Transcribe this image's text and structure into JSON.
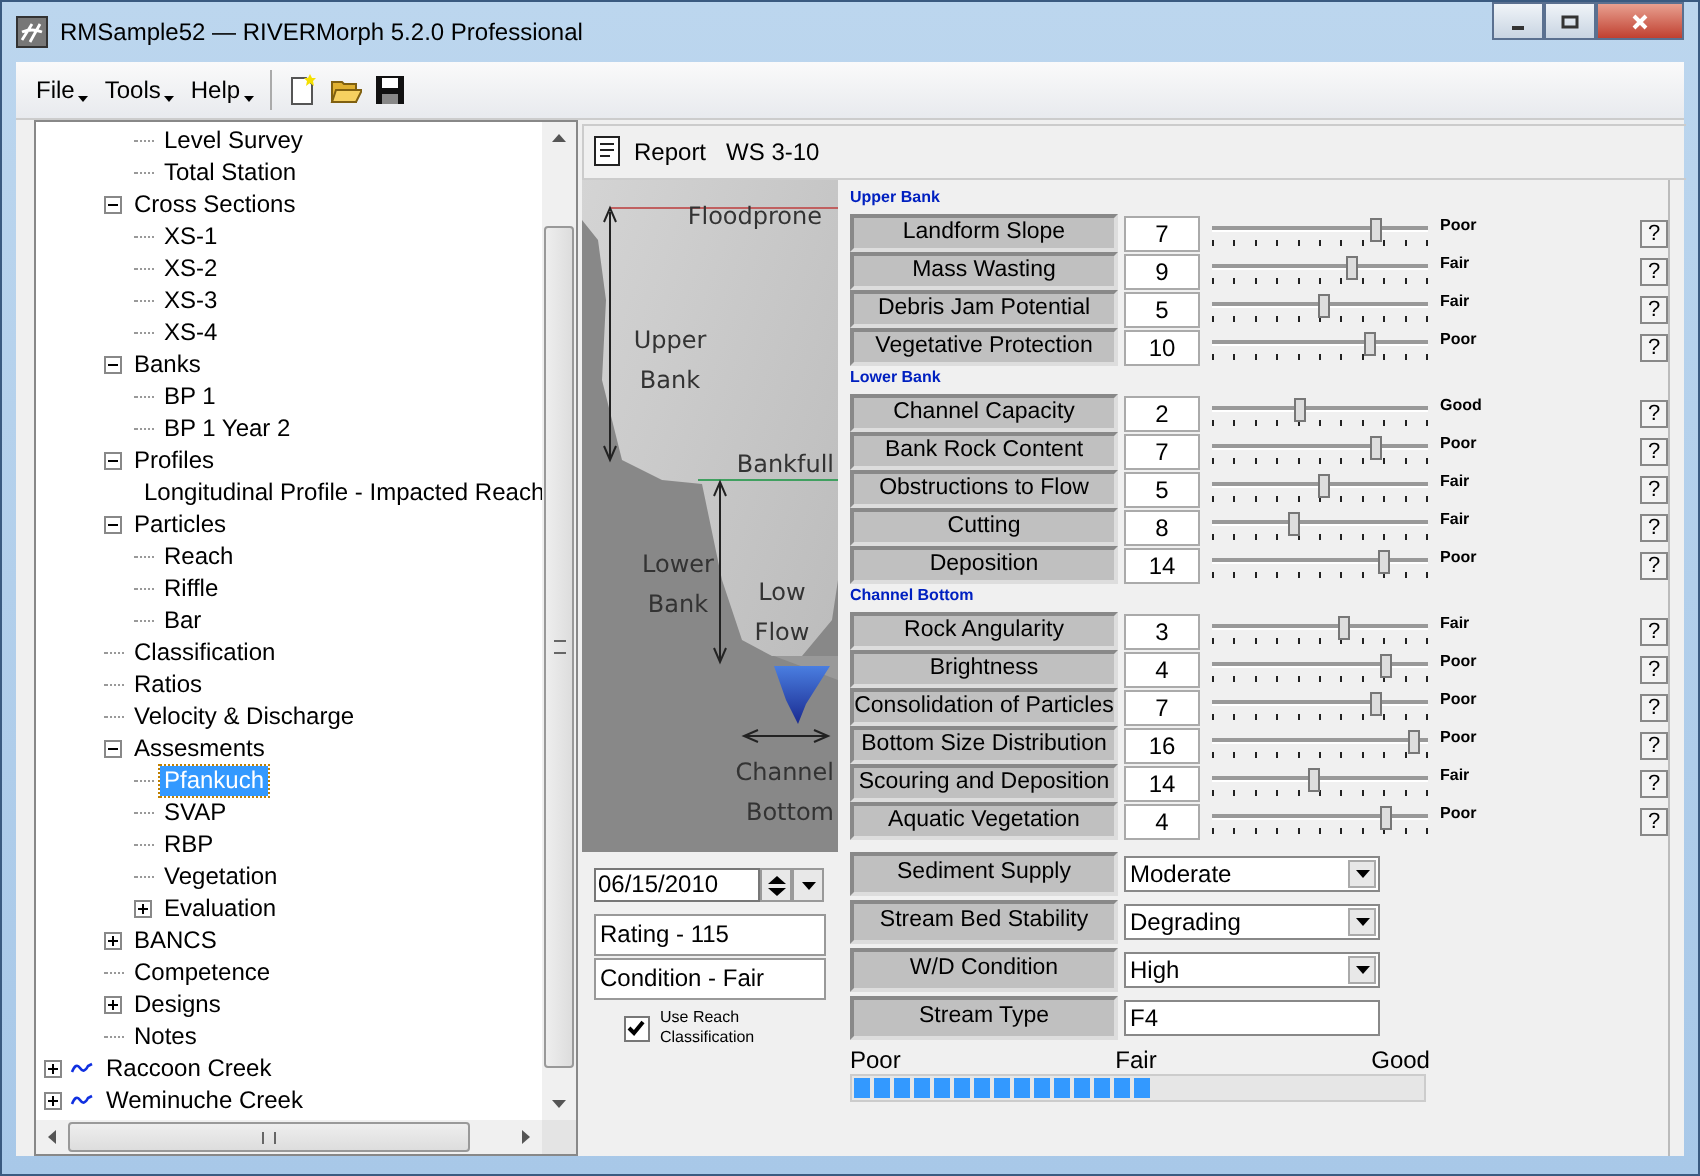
{
  "window": {
    "title": "RMSample52 — RIVERMorph 5.2.0 Professional"
  },
  "menu": [
    {
      "label": "File"
    },
    {
      "label": "Tools"
    },
    {
      "label": "Help"
    }
  ],
  "tree": [
    {
      "children": [
        {
          "children": [
            {
              "children": [
                {
                  "label": "Level Survey",
                  "selected": false
                },
                {
                  "label": "Total Station",
                  "selected": false
                }
              ]
            },
            {
              "label": "Cross Sections",
              "selected": false,
              "expanded": true,
              "children": [
                {
                  "label": "XS-1",
                  "selected": false
                },
                {
                  "label": "XS-2",
                  "selected": false
                },
                {
                  "label": "XS-3",
                  "selected": false
                },
                {
                  "label": "XS-4",
                  "selected": false
                }
              ]
            },
            {
              "label": "Banks",
              "selected": false,
              "expanded": true,
              "children": [
                {
                  "label": "BP 1",
                  "selected": false
                },
                {
                  "label": "BP 1 Year 2",
                  "selected": false
                }
              ]
            },
            {
              "label": "Profiles",
              "selected": false,
              "expanded": true,
              "children": [
                {
                  "label": "Longitudinal Profile - Impacted Reach",
                  "selected": false
                }
              ]
            },
            {
              "label": "Particles",
              "selected": false,
              "expanded": true,
              "children": [
                {
                  "label": "Reach",
                  "selected": false
                },
                {
                  "label": "Riffle",
                  "selected": false
                },
                {
                  "label": "Bar",
                  "selected": false
                }
              ]
            },
            {
              "label": "Classification",
              "selected": false
            },
            {
              "label": "Ratios",
              "selected": false
            },
            {
              "label": "Velocity & Discharge",
              "selected": false
            },
            {
              "label": "Assesments",
              "selected": false,
              "expanded": true,
              "children": [
                {
                  "label": "Pfankuch",
                  "selected": true
                },
                {
                  "label": "SVAP",
                  "selected": false
                },
                {
                  "label": "RBP",
                  "selected": false
                },
                {
                  "label": "Vegetation",
                  "selected": false
                },
                {
                  "label": "Evaluation",
                  "selected": false,
                  "expanded": false
                }
              ]
            },
            {
              "label": "BANCS",
              "selected": false,
              "expanded": false
            },
            {
              "label": "Competence",
              "selected": false
            },
            {
              "label": "Designs",
              "selected": false,
              "expanded": false
            },
            {
              "label": "Notes",
              "selected": false
            }
          ]
        }
      ]
    },
    {
      "label": "Raccoon Creek",
      "selected": false,
      "expanded": false,
      "kind": "stream"
    },
    {
      "label": "Weminuche Creek",
      "selected": false,
      "expanded": false,
      "kind": "stream"
    }
  ],
  "report": {
    "button": "Report",
    "title": "WS 3-10"
  },
  "diagram": {
    "floodprone": "Floodprone",
    "upper_bank": "Upper Bank",
    "bankfull": "Bankfull",
    "lower_bank": "Lower Bank",
    "low_flow": "Low Flow",
    "channel_bottom": "Channel Bottom"
  },
  "date": "06/15/2010",
  "rating": "Rating -  115",
  "condition": "Condition - Fair",
  "use_reach": {
    "label": "Use Reach Classification",
    "checked": true
  },
  "sections": [
    {
      "title": "Upper Bank",
      "rows": [
        {
          "label": "Landform Slope",
          "value": "7",
          "level": 0.75,
          "rating": "Poor",
          "help": "?"
        },
        {
          "label": "Mass Wasting",
          "value": "9",
          "level": 0.64,
          "rating": "Fair",
          "help": "?"
        },
        {
          "label": "Debris Jam Potential",
          "value": "5",
          "level": 0.51,
          "rating": "Fair",
          "help": "?"
        },
        {
          "label": "Vegetative Protection",
          "value": "10",
          "level": 0.72,
          "rating": "Poor",
          "help": "?"
        }
      ]
    },
    {
      "title": "Lower Bank",
      "rows": [
        {
          "label": "Channel Capacity",
          "value": "2",
          "level": 0.4,
          "rating": "Good",
          "help": "?"
        },
        {
          "label": "Bank Rock Content",
          "value": "7",
          "level": 0.75,
          "rating": "Poor",
          "help": "?"
        },
        {
          "label": "Obstructions to Flow",
          "value": "5",
          "level": 0.51,
          "rating": "Fair",
          "help": "?"
        },
        {
          "label": "Cutting",
          "value": "8",
          "level": 0.37,
          "rating": "Fair",
          "help": "?"
        },
        {
          "label": "Deposition",
          "value": "14",
          "level": 0.79,
          "rating": "Poor",
          "help": "?"
        }
      ]
    },
    {
      "title": "Channel Bottom",
      "rows": [
        {
          "label": "Rock Angularity",
          "value": "3",
          "level": 0.6,
          "rating": "Fair",
          "help": "?"
        },
        {
          "label": "Brightness",
          "value": "4",
          "level": 0.8,
          "rating": "Poor",
          "help": "?"
        },
        {
          "label": "Consolidation of Particles",
          "value": "7",
          "level": 0.75,
          "rating": "Poor",
          "help": "?"
        },
        {
          "label": "Bottom Size Distribution",
          "value": "16",
          "level": 0.93,
          "rating": "Poor",
          "help": "?"
        },
        {
          "label": "Scouring and Deposition",
          "value": "14",
          "level": 0.46,
          "rating": "Fair",
          "help": "?"
        },
        {
          "label": "Aquatic Vegetation",
          "value": "4",
          "level": 0.8,
          "rating": "Poor",
          "help": "?"
        }
      ]
    }
  ],
  "fields": [
    {
      "label": "Sediment Supply",
      "value": "Moderate",
      "kind": "dropdown"
    },
    {
      "label": "Stream Bed Stability",
      "value": "Degrading",
      "kind": "dropdown"
    },
    {
      "label": "W/D Condition",
      "value": "High",
      "kind": "dropdown"
    },
    {
      "label": "Stream Type",
      "value": "F4",
      "kind": "text"
    }
  ],
  "scale": {
    "labels": [
      "Poor",
      "Fair",
      "Good"
    ],
    "level": 0.52
  }
}
